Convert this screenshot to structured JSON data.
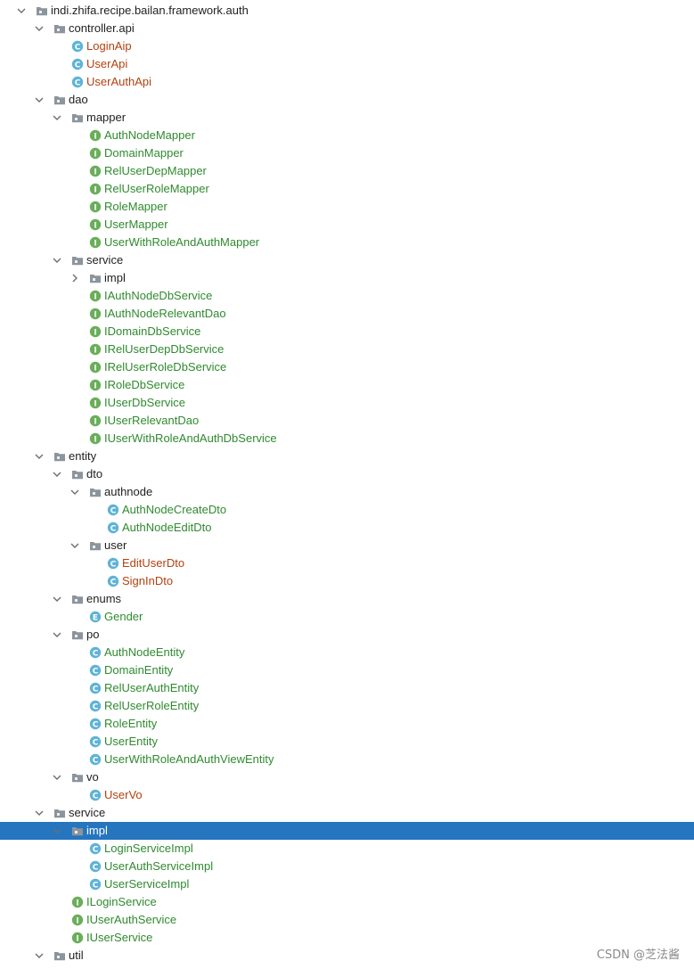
{
  "tree": [
    {
      "d": 0,
      "kind": "package",
      "label": "indi.zhifa.recipe.bailan.framework.auth",
      "arrow": "down",
      "color": "dark"
    },
    {
      "d": 1,
      "kind": "package",
      "label": "controller.api",
      "arrow": "down",
      "color": "dark"
    },
    {
      "d": 2,
      "kind": "class",
      "label": "LoginAip",
      "color": "orange"
    },
    {
      "d": 2,
      "kind": "class",
      "label": "UserApi",
      "color": "orange"
    },
    {
      "d": 2,
      "kind": "class",
      "label": "UserAuthApi",
      "color": "orange"
    },
    {
      "d": 1,
      "kind": "package",
      "label": "dao",
      "arrow": "down",
      "color": "dark"
    },
    {
      "d": 2,
      "kind": "package",
      "label": "mapper",
      "arrow": "down",
      "color": "dark"
    },
    {
      "d": 3,
      "kind": "interface",
      "label": "AuthNodeMapper",
      "color": "green"
    },
    {
      "d": 3,
      "kind": "interface",
      "label": "DomainMapper",
      "color": "green"
    },
    {
      "d": 3,
      "kind": "interface",
      "label": "RelUserDepMapper",
      "color": "green"
    },
    {
      "d": 3,
      "kind": "interface",
      "label": "RelUserRoleMapper",
      "color": "green"
    },
    {
      "d": 3,
      "kind": "interface",
      "label": "RoleMapper",
      "color": "green"
    },
    {
      "d": 3,
      "kind": "interface",
      "label": "UserMapper",
      "color": "green"
    },
    {
      "d": 3,
      "kind": "interface",
      "label": "UserWithRoleAndAuthMapper",
      "color": "green"
    },
    {
      "d": 2,
      "kind": "package",
      "label": "service",
      "arrow": "down",
      "color": "dark"
    },
    {
      "d": 3,
      "kind": "package",
      "label": "impl",
      "arrow": "right",
      "color": "dark"
    },
    {
      "d": 3,
      "kind": "interface",
      "label": "IAuthNodeDbService",
      "color": "green"
    },
    {
      "d": 3,
      "kind": "interface",
      "label": "IAuthNodeRelevantDao",
      "color": "green"
    },
    {
      "d": 3,
      "kind": "interface",
      "label": "IDomainDbService",
      "color": "green"
    },
    {
      "d": 3,
      "kind": "interface",
      "label": "IRelUserDepDbService",
      "color": "green"
    },
    {
      "d": 3,
      "kind": "interface",
      "label": "IRelUserRoleDbService",
      "color": "green"
    },
    {
      "d": 3,
      "kind": "interface",
      "label": "IRoleDbService",
      "color": "green"
    },
    {
      "d": 3,
      "kind": "interface",
      "label": "IUserDbService",
      "color": "green"
    },
    {
      "d": 3,
      "kind": "interface",
      "label": "IUserRelevantDao",
      "color": "green"
    },
    {
      "d": 3,
      "kind": "interface",
      "label": "IUserWithRoleAndAuthDbService",
      "color": "green"
    },
    {
      "d": 1,
      "kind": "package",
      "label": "entity",
      "arrow": "down",
      "color": "dark"
    },
    {
      "d": 2,
      "kind": "package",
      "label": "dto",
      "arrow": "down",
      "color": "dark"
    },
    {
      "d": 3,
      "kind": "package",
      "label": "authnode",
      "arrow": "down",
      "color": "dark"
    },
    {
      "d": 4,
      "kind": "class",
      "label": "AuthNodeCreateDto",
      "color": "green"
    },
    {
      "d": 4,
      "kind": "class",
      "label": "AuthNodeEditDto",
      "color": "green"
    },
    {
      "d": 3,
      "kind": "package",
      "label": "user",
      "arrow": "down",
      "color": "dark"
    },
    {
      "d": 4,
      "kind": "class",
      "label": "EditUserDto",
      "color": "orange"
    },
    {
      "d": 4,
      "kind": "class",
      "label": "SignInDto",
      "color": "orange"
    },
    {
      "d": 2,
      "kind": "package",
      "label": "enums",
      "arrow": "down",
      "color": "dark"
    },
    {
      "d": 3,
      "kind": "enum",
      "label": "Gender",
      "color": "green"
    },
    {
      "d": 2,
      "kind": "package",
      "label": "po",
      "arrow": "down",
      "color": "dark"
    },
    {
      "d": 3,
      "kind": "class",
      "label": "AuthNodeEntity",
      "color": "green"
    },
    {
      "d": 3,
      "kind": "class",
      "label": "DomainEntity",
      "color": "green"
    },
    {
      "d": 3,
      "kind": "class",
      "label": "RelUserAuthEntity",
      "color": "green"
    },
    {
      "d": 3,
      "kind": "class",
      "label": "RelUserRoleEntity",
      "color": "green"
    },
    {
      "d": 3,
      "kind": "class",
      "label": "RoleEntity",
      "color": "green"
    },
    {
      "d": 3,
      "kind": "class",
      "label": "UserEntity",
      "color": "green"
    },
    {
      "d": 3,
      "kind": "class",
      "label": "UserWithRoleAndAuthViewEntity",
      "color": "green"
    },
    {
      "d": 2,
      "kind": "package",
      "label": "vo",
      "arrow": "down",
      "color": "dark"
    },
    {
      "d": 3,
      "kind": "class",
      "label": "UserVo",
      "color": "orange"
    },
    {
      "d": 1,
      "kind": "package",
      "label": "service",
      "arrow": "down",
      "color": "dark"
    },
    {
      "d": 2,
      "kind": "package",
      "label": "impl",
      "arrow": "down",
      "color": "dark",
      "selected": true
    },
    {
      "d": 3,
      "kind": "class",
      "label": "LoginServiceImpl",
      "color": "green"
    },
    {
      "d": 3,
      "kind": "class",
      "label": "UserAuthServiceImpl",
      "color": "green"
    },
    {
      "d": 3,
      "kind": "class",
      "label": "UserServiceImpl",
      "color": "green"
    },
    {
      "d": 2,
      "kind": "interface",
      "label": "ILoginService",
      "color": "green"
    },
    {
      "d": 2,
      "kind": "interface",
      "label": "IUserAuthService",
      "color": "green"
    },
    {
      "d": 2,
      "kind": "interface",
      "label": "IUserService",
      "color": "green"
    },
    {
      "d": 1,
      "kind": "package",
      "label": "util",
      "arrow": "down",
      "color": "dark"
    }
  ],
  "watermark": "CSDN @芝法酱",
  "colors": {
    "class_icon": "#5fb3d6",
    "interface_icon": "#6aae5a",
    "enum_icon": "#5fb3d6",
    "folder": "#8c949c",
    "selection": "#2675bf",
    "label_orange": "#b4410f",
    "label_green": "#2f8a2f"
  }
}
